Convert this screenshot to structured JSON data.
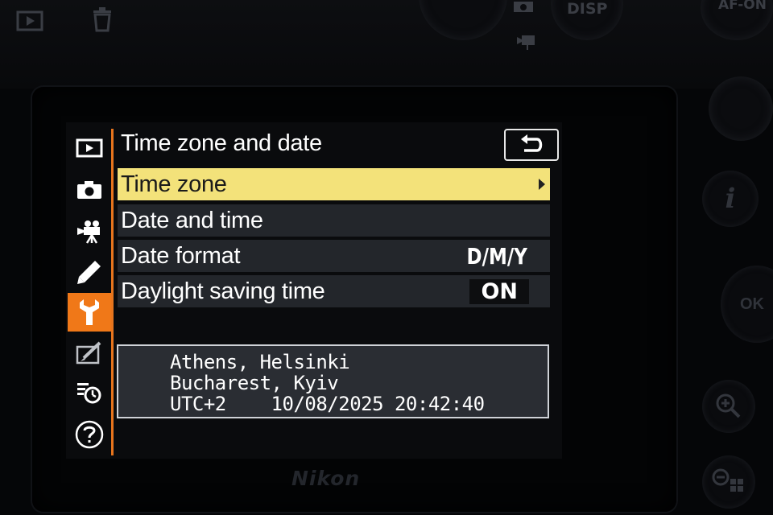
{
  "camera": {
    "top_buttons": {
      "disp_label": "DISP",
      "af_on_label": "AF-ON"
    },
    "brand": "Nikon",
    "right_buttons": {
      "info_label": "i",
      "ok_label": "OK"
    }
  },
  "menu": {
    "title": "Time zone and date",
    "tabs": [
      {
        "icon": "playback-icon"
      },
      {
        "icon": "camera-icon"
      },
      {
        "icon": "movie-camera-icon"
      },
      {
        "icon": "pencil-icon"
      },
      {
        "icon": "wrench-icon",
        "active": true
      },
      {
        "icon": "retouch-icon"
      },
      {
        "icon": "my-menu-icon"
      },
      {
        "icon": "help-icon"
      }
    ],
    "items": [
      {
        "label": "Time zone",
        "value": "",
        "selected": true
      },
      {
        "label": "Date and time",
        "value": ""
      },
      {
        "label": "Date format",
        "value": "D/M/Y"
      },
      {
        "label": "Daylight saving time",
        "value": "ON"
      }
    ],
    "info": {
      "line1": "Athens, Helsinki",
      "line2": "Bucharest, Kyiv",
      "line3": "UTC+2    10/08/2025 20:42:40"
    }
  },
  "colors": {
    "accent_orange": "#f07818",
    "selection_yellow": "#f3e27a",
    "item_bg": "#23262b",
    "panel_bg": "#2a2d33"
  }
}
